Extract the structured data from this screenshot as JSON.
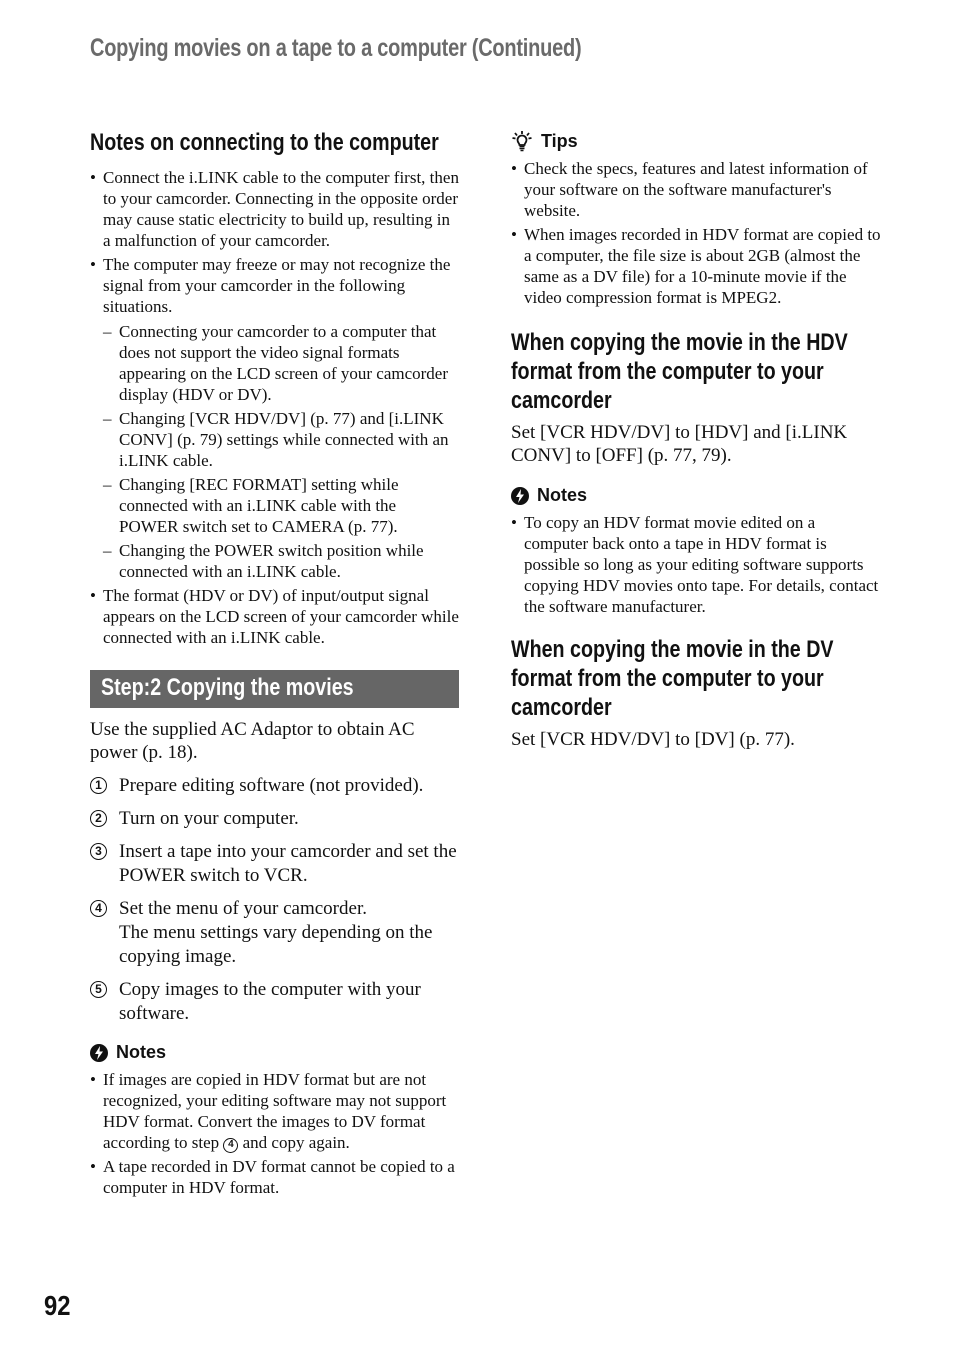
{
  "header": {
    "title": "Copying movies on a tape to a computer (Continued)"
  },
  "left": {
    "notes_connecting": {
      "heading": "Notes on connecting to the computer",
      "bullets": [
        "Connect the i.LINK cable to the computer first, then to your camcorder. Connecting in the opposite order may cause static electricity to build up, resulting in a malfunction of your camcorder.",
        "The computer may freeze or may not recognize the signal from your camcorder in the following situations."
      ],
      "sub_items": [
        "Connecting your camcorder to a computer that does not support the video signal formats appearing on the LCD screen of your camcorder display (HDV or DV).",
        "Changing [VCR HDV/DV] (p. 77) and [i.LINK CONV] (p. 79) settings while connected with an i.LINK cable.",
        "Changing [REC FORMAT] setting while connected with an i.LINK cable with the POWER switch set to CAMERA (p. 77).",
        "Changing the POWER switch position while connected with an i.LINK cable."
      ],
      "last_bullet": "The format (HDV or DV) of input/output signal appears on the LCD screen of your camcorder while connected with an i.LINK cable."
    },
    "step2": {
      "banner": "Step:2 Copying the movies",
      "intro": "Use the supplied AC Adaptor to obtain AC power (p. 18).",
      "steps": [
        {
          "num": "1",
          "text": "Prepare editing software (not provided)."
        },
        {
          "num": "2",
          "text": "Turn on your computer."
        },
        {
          "num": "3",
          "text": "Insert a tape into your camcorder and set the POWER switch to VCR."
        },
        {
          "num": "4",
          "text": "Set the menu of your camcorder.",
          "extra": "The menu settings vary depending on the copying image."
        },
        {
          "num": "5",
          "text": "Copy images to the computer with your software."
        }
      ],
      "notes_label": "Notes",
      "notes": {
        "b1_part1": "If images are copied in HDV format but are not recognized, your editing software may not support HDV format. Convert the images to DV format according to step ",
        "b1_step": "4",
        "b1_part2": " and copy again.",
        "b2": "A tape recorded in DV format cannot be copied to a computer in HDV format."
      }
    }
  },
  "right": {
    "tips": {
      "label": "Tips",
      "bullets": [
        "Check the specs, features and latest information of your software on the software manufacturer's website.",
        "When images recorded in HDV format are copied to a computer, the file size is about 2GB (almost the same as a DV file) for a 10-minute movie if the video compression format is MPEG2."
      ]
    },
    "hdv_section": {
      "heading_lines": [
        "When copying the movie in the HDV",
        "format from the computer to your",
        "camcorder"
      ],
      "body": "Set [VCR HDV/DV] to [HDV] and [i.LINK CONV] to [OFF] (p. 77, 79).",
      "notes_label": "Notes",
      "notes": [
        "To copy an HDV format movie edited on a computer back onto a tape in HDV format is possible so long as your editing software supports copying HDV movies onto tape. For details, contact the software manufacturer."
      ]
    },
    "dv_section": {
      "heading_lines": [
        "When copying the movie in the DV",
        "format from the computer to your",
        "camcorder"
      ],
      "body": "Set [VCR HDV/DV] to [DV] (p. 77)."
    }
  },
  "footer": {
    "page_number": "92"
  }
}
